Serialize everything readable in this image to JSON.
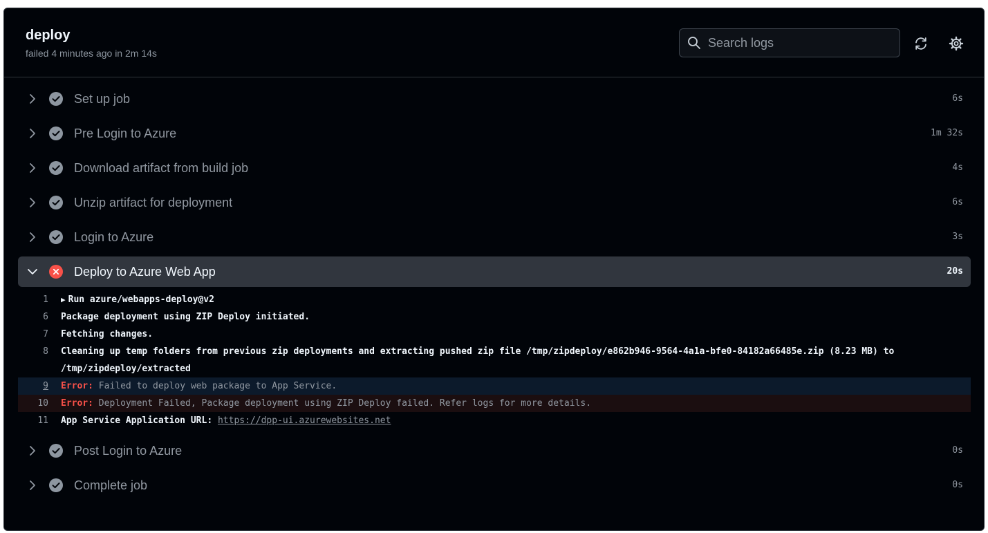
{
  "job": {
    "title": "deploy",
    "status": "failed 4 minutes ago in 2m 14s"
  },
  "toolbar": {
    "search_placeholder": "Search logs",
    "refresh_icon": "sync-icon",
    "settings_icon": "gear-icon"
  },
  "colors": {
    "success": "#8d96a0",
    "failure": "#f85149",
    "background": "#010409",
    "expanded_row": "#31363e"
  },
  "steps_before": [
    {
      "name": "Set up job",
      "duration": "6s",
      "status": "success"
    },
    {
      "name": "Pre Login to Azure",
      "duration": "1m 32s",
      "status": "success"
    },
    {
      "name": "Download artifact from build job",
      "duration": "4s",
      "status": "success"
    },
    {
      "name": "Unzip artifact for deployment",
      "duration": "6s",
      "status": "success"
    },
    {
      "name": "Login to Azure",
      "duration": "3s",
      "status": "success"
    }
  ],
  "expanded_step": {
    "name": "Deploy to Azure Web App",
    "duration": "20s",
    "status": "failure",
    "log": {
      "l1": {
        "num": "1",
        "text": "Run azure/webapps-deploy@v2"
      },
      "l6": {
        "num": "6",
        "text": "Package deployment using ZIP Deploy initiated."
      },
      "l7": {
        "num": "7",
        "text": "Fetching changes."
      },
      "l8": {
        "num": "8",
        "text": "Cleaning up temp folders from previous zip deployments and extracting pushed zip file /tmp/zipdeploy/e862b946-9564-4a1a-bfe0-84182a66485e.zip (8.23 MB) to /tmp/zipdeploy/extracted"
      },
      "l9": {
        "num": "9",
        "label": "Error:",
        "text": " Failed to deploy web package to App Service."
      },
      "l10": {
        "num": "10",
        "label": "Error:",
        "text": " Deployment Failed, Package deployment using ZIP Deploy failed. Refer logs for more details."
      },
      "l11": {
        "num": "11",
        "text": "App Service Application URL: ",
        "url": "https://dpp-ui.azurewebsites.net"
      }
    }
  },
  "steps_after": [
    {
      "name": "Post Login to Azure",
      "duration": "0s",
      "status": "success"
    },
    {
      "name": "Complete job",
      "duration": "0s",
      "status": "success"
    }
  ]
}
